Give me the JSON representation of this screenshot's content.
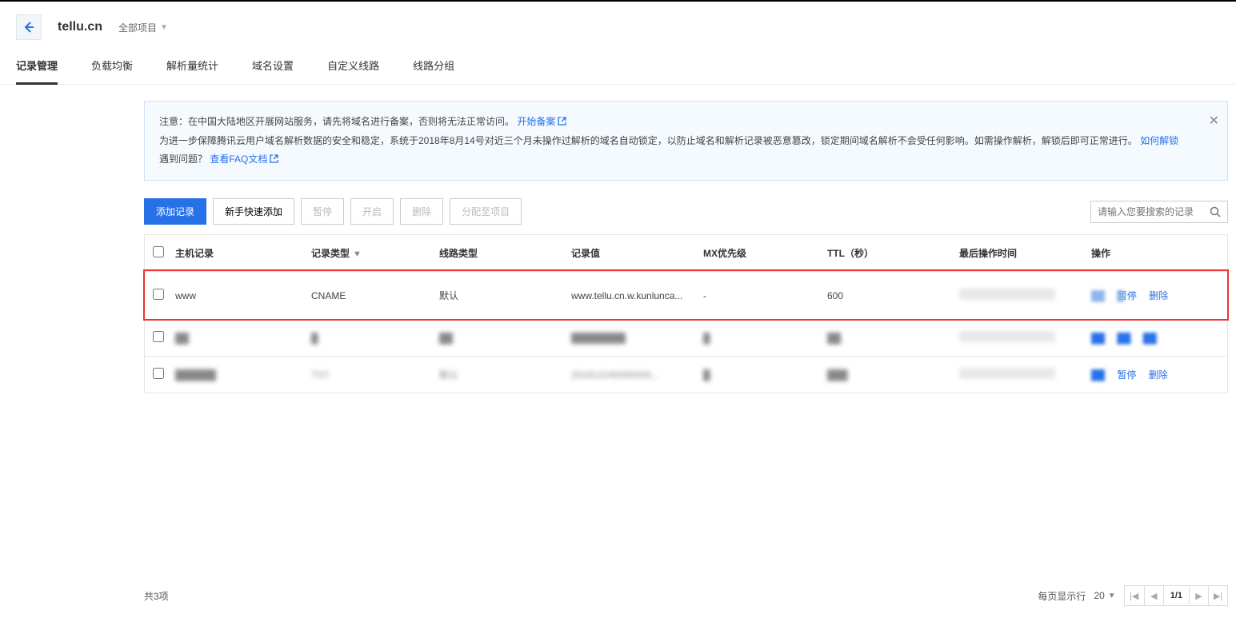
{
  "header": {
    "domain": "tellu.cn",
    "project_selector": "全部项目"
  },
  "tabs": [
    {
      "label": "记录管理",
      "active": true
    },
    {
      "label": "负载均衡"
    },
    {
      "label": "解析量统计"
    },
    {
      "label": "域名设置"
    },
    {
      "label": "自定义线路"
    },
    {
      "label": "线路分组"
    }
  ],
  "notice": {
    "line1_prefix": "注意：在中国大陆地区开展网站服务，请先将域名进行备案，否则将无法正常访问。",
    "link1": "开始备案",
    "line2_prefix": "为进一步保障腾讯云用户域名解析数据的安全和稳定，系统于2018年8月14号对近三个月未操作过解析的域名自动锁定，以防止域名和解析记录被恶意篡改，锁定期间域名解析不会受任何影响。如需操作解析，解锁后即可正常进行。",
    "link2": "如何解锁",
    "line3_prefix": "遇到问题？",
    "link3": "查看FAQ文档"
  },
  "toolbar": {
    "add_record": "添加记录",
    "quick_add": "新手快速添加",
    "pause": "暂停",
    "enable": "开启",
    "delete": "删除",
    "assign": "分配至项目",
    "search_placeholder": "请输入您要搜索的记录"
  },
  "columns": {
    "host": "主机记录",
    "type": "记录类型",
    "line": "线路类型",
    "value": "记录值",
    "mx": "MX优先级",
    "ttl": "TTL（秒）",
    "time": "最后操作时间",
    "ops": "操作"
  },
  "rows": [
    {
      "host": "www",
      "type": "CNAME",
      "line": "默认",
      "value": "www.tellu.cn.w.kunlunca...",
      "mx": "-",
      "ttl": "600",
      "time": "",
      "ops_pause": "暂停",
      "ops_delete": "删除",
      "highlight": true
    },
    {
      "host": "@",
      "type": "",
      "line": "",
      "value": "",
      "mx": "",
      "ttl": "",
      "time": "",
      "ops_pause": "",
      "ops_delete": "",
      "blur": true
    },
    {
      "host": "",
      "type": "TXT",
      "line": "默认",
      "value": "201812240000000...",
      "mx": "",
      "ttl": "",
      "time": "",
      "ops_pause": "暂停",
      "ops_delete": "删除",
      "blur": true
    }
  ],
  "footer": {
    "total": "共3项",
    "per_page_label": "每页显示行",
    "per_page_value": "20",
    "page": "1/1"
  }
}
